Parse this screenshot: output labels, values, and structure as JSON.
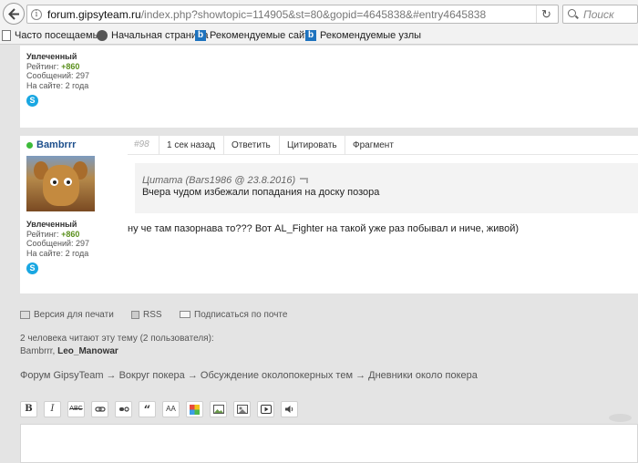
{
  "browser": {
    "url_host": "forum.gipsyteam.ru",
    "url_rest": "/index.php?showtopic=114905&st=80&gopid=4645838&#entry4645838",
    "search_placeholder": "Поиск",
    "bookmarks": [
      {
        "label": "Часто посещаемые",
        "icon": "firefox-icon"
      },
      {
        "label": "Начальная страница",
        "icon": "firefox-icon"
      },
      {
        "label": "Рекомендуемые сайты",
        "icon": "bing-icon"
      },
      {
        "label": "Рекомендуемые узлы",
        "icon": "bing-icon"
      }
    ]
  },
  "prev_post": {
    "role": "Увлеченный",
    "rating_label": "Рейтинг:",
    "rating_value": "+860",
    "messages": "Сообщений: 297",
    "on_site": "На сайте: 2 года",
    "skype_glyph": "S"
  },
  "post": {
    "username": "Bambrrr",
    "number": "#98",
    "time": "1 сек назад",
    "reply": "Ответить",
    "quote_btn": "Цитировать",
    "fragment": "Фрагмент",
    "quote_head": "Цитата (Bars1986 @ 23.8.2016)",
    "quote_text": "Вчера чудом избежали попадания на доску позора",
    "text": "ну че там пазорнава то??? Вот AL_Fighter на такой уже раз побывал и ниче, живой)",
    "role": "Увлеченный",
    "rating_label": "Рейтинг:",
    "rating_value": "+860",
    "messages": "Сообщений: 297",
    "on_site": "На сайте: 2 года",
    "skype_glyph": "S",
    "online_color": "#3dbb3a"
  },
  "links": {
    "print": "Версия для печати",
    "rss": "RSS",
    "subscribe": "Подписаться по почте"
  },
  "readers": {
    "summary": "2 человека читают эту тему (2 пользователя):",
    "name1": "Bambrrr, ",
    "name2": "Leo_Manowar"
  },
  "breadcrumb": "Форум GipsyTeam → Вокруг покера → Обсуждение околопокерных тем → Дневники около покера",
  "editor": {
    "bold": "B",
    "italic": "I",
    "strike": "ABC",
    "quote": "“",
    "font_size": "AA"
  }
}
